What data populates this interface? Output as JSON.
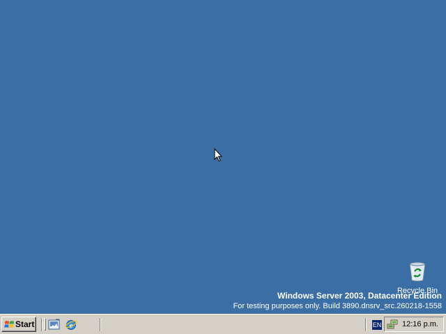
{
  "desktop": {
    "background_color": "#3a6ea5",
    "icons": [
      {
        "label": "Recycle Bin",
        "icon": "recycle-bin-icon"
      }
    ],
    "watermark": {
      "title": "Windows Server 2003, Datacenter Edition",
      "build": "For testing purposes only. Build 3890.dnsrv_src.260218-1558"
    }
  },
  "taskbar": {
    "start_label": "Start",
    "quick_launch": [
      {
        "name": "show-desktop",
        "icon": "show-desktop-icon"
      },
      {
        "name": "internet-explorer",
        "icon": "internet-explorer-icon"
      }
    ],
    "language": "EN",
    "tray_icons": [
      "network-icon"
    ],
    "clock": "12:16 p.m."
  }
}
